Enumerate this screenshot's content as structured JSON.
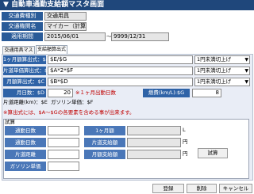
{
  "window": {
    "title": "自動車通勤支給額マスタ画面"
  },
  "header": {
    "division_label": "交通費種別",
    "division_value": "交通用具",
    "transport_label": "交通機関名",
    "transport_value": "マイカー（計算式）",
    "period_label": "適用期間",
    "period_start": "2015/06/01",
    "period_sep": "～",
    "period_end": "9999/12/31"
  },
  "tabs": [
    {
      "label": "交通用具マスタ"
    },
    {
      "label": "支給額算出式"
    }
  ],
  "formulas": [
    {
      "label": "1ヶ月額算出式：$A",
      "value": "$E/$G",
      "rounding": "1円未満切上げ"
    },
    {
      "label": "片道単価算出式：$B",
      "value": "$A*2*$F",
      "rounding": "1円未満切上げ"
    },
    {
      "label": "月額算出式：$C",
      "value": "$B*$D",
      "rounding": "1円未満切上げ"
    }
  ],
  "params": {
    "monthly_days_label": "月日数：$D",
    "monthly_days_value": "20",
    "monthly_days_note": "※１ヶ月出勤日数",
    "fuel_label": "燃費(km/L):$G",
    "fuel_value": "8",
    "distance_text": "片道距離(km)：$E",
    "gas_text": "ガソリン単価：$F"
  },
  "note": "※算出式には、$A～$Gの各要素を含める事が出来ます。",
  "trial": {
    "section_label": "試算",
    "fields_left": [
      {
        "label": "通勤日数"
      },
      {
        "label": "通勤日数"
      },
      {
        "label": "片道距離"
      },
      {
        "label": "ガソリン単価"
      }
    ],
    "fields_right": [
      {
        "label": "1ヶ月額",
        "unit": "L"
      },
      {
        "label": "片道支給額",
        "unit": "円"
      },
      {
        "label": "月額支給額",
        "unit": "円"
      }
    ],
    "calc_button": "試算"
  },
  "footer": {
    "register_button": "登録",
    "delete_button": "削除",
    "cancel_button": "キャンセル"
  }
}
